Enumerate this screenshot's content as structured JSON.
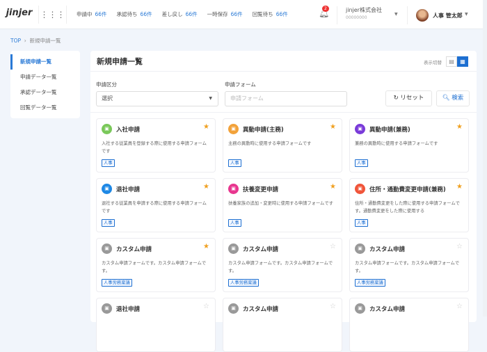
{
  "header": {
    "logo": "jinjer",
    "status": [
      {
        "label": "申請中",
        "count": "66件"
      },
      {
        "label": "承認待ち",
        "count": "66件"
      },
      {
        "label": "差し戻し",
        "count": "66件"
      },
      {
        "label": "一時保存",
        "count": "66件"
      },
      {
        "label": "回覧待ち",
        "count": "66件"
      }
    ],
    "notification_count": "2",
    "company": "jinjer株式会社",
    "company_id": "00000000",
    "user": "人事 管太郎"
  },
  "breadcrumb": {
    "top": "TOP",
    "current": "新規申請一覧"
  },
  "sidebar": {
    "items": [
      {
        "label": "新規申請一覧",
        "active": true
      },
      {
        "label": "申請データ一覧"
      },
      {
        "label": "承認データ一覧"
      },
      {
        "label": "回覧データ一覧"
      }
    ]
  },
  "main": {
    "title": "新規申請一覧",
    "view_toggle_label": "表示切替",
    "filters": {
      "category_label": "申請区分",
      "category_value": "選択",
      "form_label": "申請フォーム",
      "form_placeholder": "申請フォーム",
      "reset": "リセット",
      "search": "検索"
    },
    "cards": [
      {
        "title": "入社申請",
        "desc": "入社する従業員を登録する際に使用する申請フォームです",
        "tag": "人事",
        "color": "#7ac85a",
        "starred": true
      },
      {
        "title": "異動申請(主務)",
        "desc": "主務の異動時に使用する申請フォームです",
        "tag": "人事",
        "color": "#f2a23a",
        "starred": true
      },
      {
        "title": "異動申請(兼務)",
        "desc": "兼務の異動時に使用する申請フォームです",
        "tag": "人事",
        "color": "#7a3bd9",
        "starred": true
      },
      {
        "title": "退社申請",
        "desc": "退社する従業員を申請する際に使用する申請フォームです",
        "tag": "人事",
        "color": "#1e88e5",
        "starred": true
      },
      {
        "title": "扶養変更申請",
        "desc": "扶養家族の追加・変更時に使用する申請フォームです",
        "tag": "人事",
        "color": "#e8368f",
        "starred": true
      },
      {
        "title": "住所・通勤費変更申請(兼務)",
        "desc": "住所・通勤費変更をした際に使用する申請フォームです。通勤費変更をした際に使用する",
        "tag": "人事",
        "color": "#f0553a",
        "starred": true
      },
      {
        "title": "カスタム申請",
        "desc": "カスタム申請フォームです。カスタム申請フォームです。",
        "tag": "人事労務稟議",
        "color": "#999",
        "starred": true
      },
      {
        "title": "カスタム申請",
        "desc": "カスタム申請フォームです。カスタム申請フォームです。",
        "tag": "人事労務稟議",
        "color": "#999",
        "starred": false
      },
      {
        "title": "カスタム申請",
        "desc": "カスタム申請フォームです。カスタム申請フォームです。",
        "tag": "人事労務稟議",
        "color": "#999",
        "starred": false
      },
      {
        "title": "退社申請",
        "color": "#999",
        "starred": false
      },
      {
        "title": "カスタム申請",
        "color": "#999",
        "starred": false
      },
      {
        "title": "カスタム申請",
        "color": "#999",
        "starred": false
      }
    ]
  }
}
